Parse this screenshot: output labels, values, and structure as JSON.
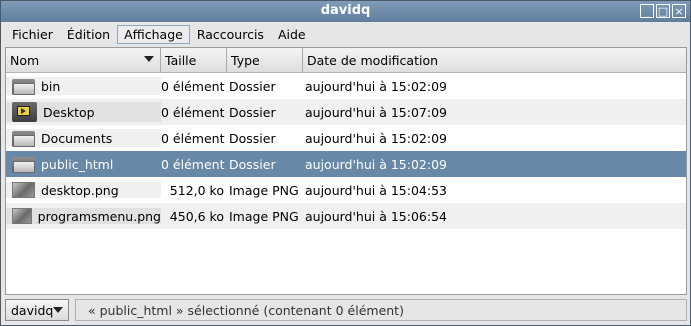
{
  "window": {
    "title": "davidq"
  },
  "menubar": [
    "Fichier",
    "Édition",
    "Affichage",
    "Raccourcis",
    "Aide"
  ],
  "columns": {
    "name": "Nom",
    "size": "Taille",
    "type": "Type",
    "date": "Date de modification"
  },
  "files": [
    {
      "name": "bin",
      "size": "0 élément",
      "type": "Dossier",
      "date": "aujourd'hui à 15:02:09",
      "icon": "folder-icon"
    },
    {
      "name": "Desktop",
      "size": "0 élément",
      "type": "Dossier",
      "date": "aujourd'hui à 15:07:09",
      "icon": "desktop-folder-icon"
    },
    {
      "name": "Documents",
      "size": "0 élément",
      "type": "Dossier",
      "date": "aujourd'hui à 15:02:09",
      "icon": "folder-icon"
    },
    {
      "name": "public_html",
      "size": "0 élément",
      "type": "Dossier",
      "date": "aujourd'hui à 15:02:09",
      "icon": "folder-icon"
    },
    {
      "name": "desktop.png",
      "size": "512,0 ko",
      "type": "Image PNG",
      "date": "aujourd'hui à 15:04:53",
      "icon": "image-thumbnail-icon"
    },
    {
      "name": "programsmenu.png",
      "size": "450,6 ko",
      "type": "Image PNG",
      "date": "aujourd'hui à 15:06:54",
      "icon": "image-thumbnail-icon"
    }
  ],
  "statusbar": {
    "location": "davidq",
    "message": "« public_html » sélectionné (contenant 0 élément)"
  }
}
